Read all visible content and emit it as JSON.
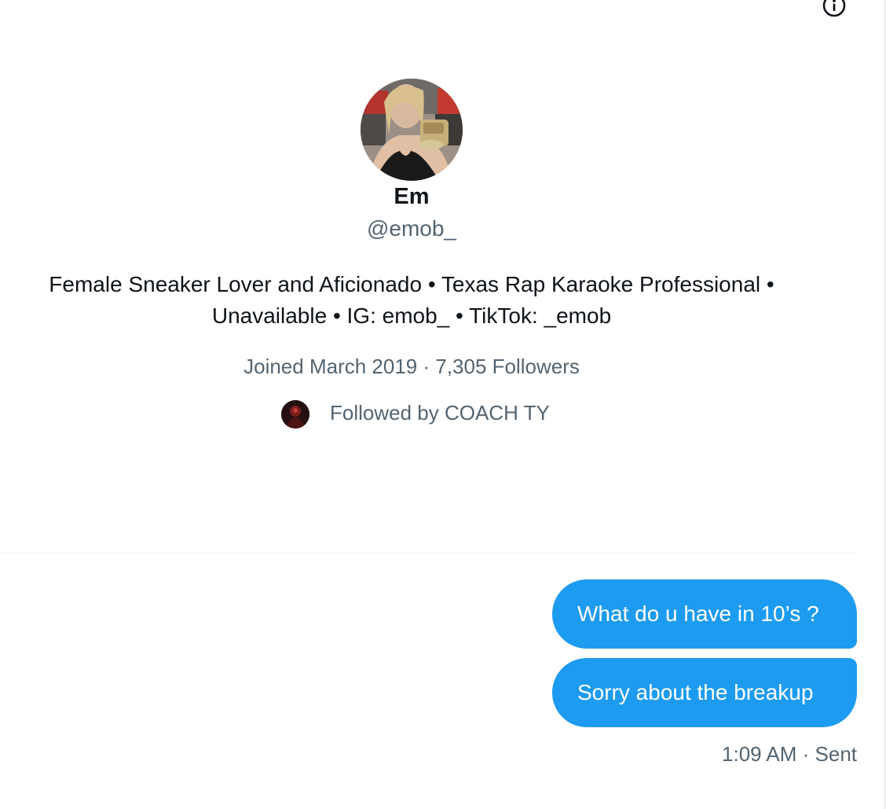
{
  "header": {
    "info_icon": "info-circle-icon"
  },
  "profile": {
    "avatar_icon": "profile-photo",
    "name": "Em",
    "handle": "@emob_",
    "bio_line1": "Female Sneaker Lover and Aficionado • Texas Rap Karaoke Professional •",
    "bio_line2": "Unavailable • IG: emob_ • TikTok: _emob",
    "meta": "Joined March 2019 · 7,305 Followers",
    "followed_by": "Followed by COACH TY"
  },
  "messages": [
    {
      "text": "What do u have in 10’s ?"
    },
    {
      "text": "Sorry about the breakup"
    }
  ],
  "status": "1:09 AM · Sent",
  "colors": {
    "accent": "#1d9bf0",
    "secondary_text": "#536471",
    "primary_text": "#0f1419",
    "divider": "#eff3f4"
  }
}
